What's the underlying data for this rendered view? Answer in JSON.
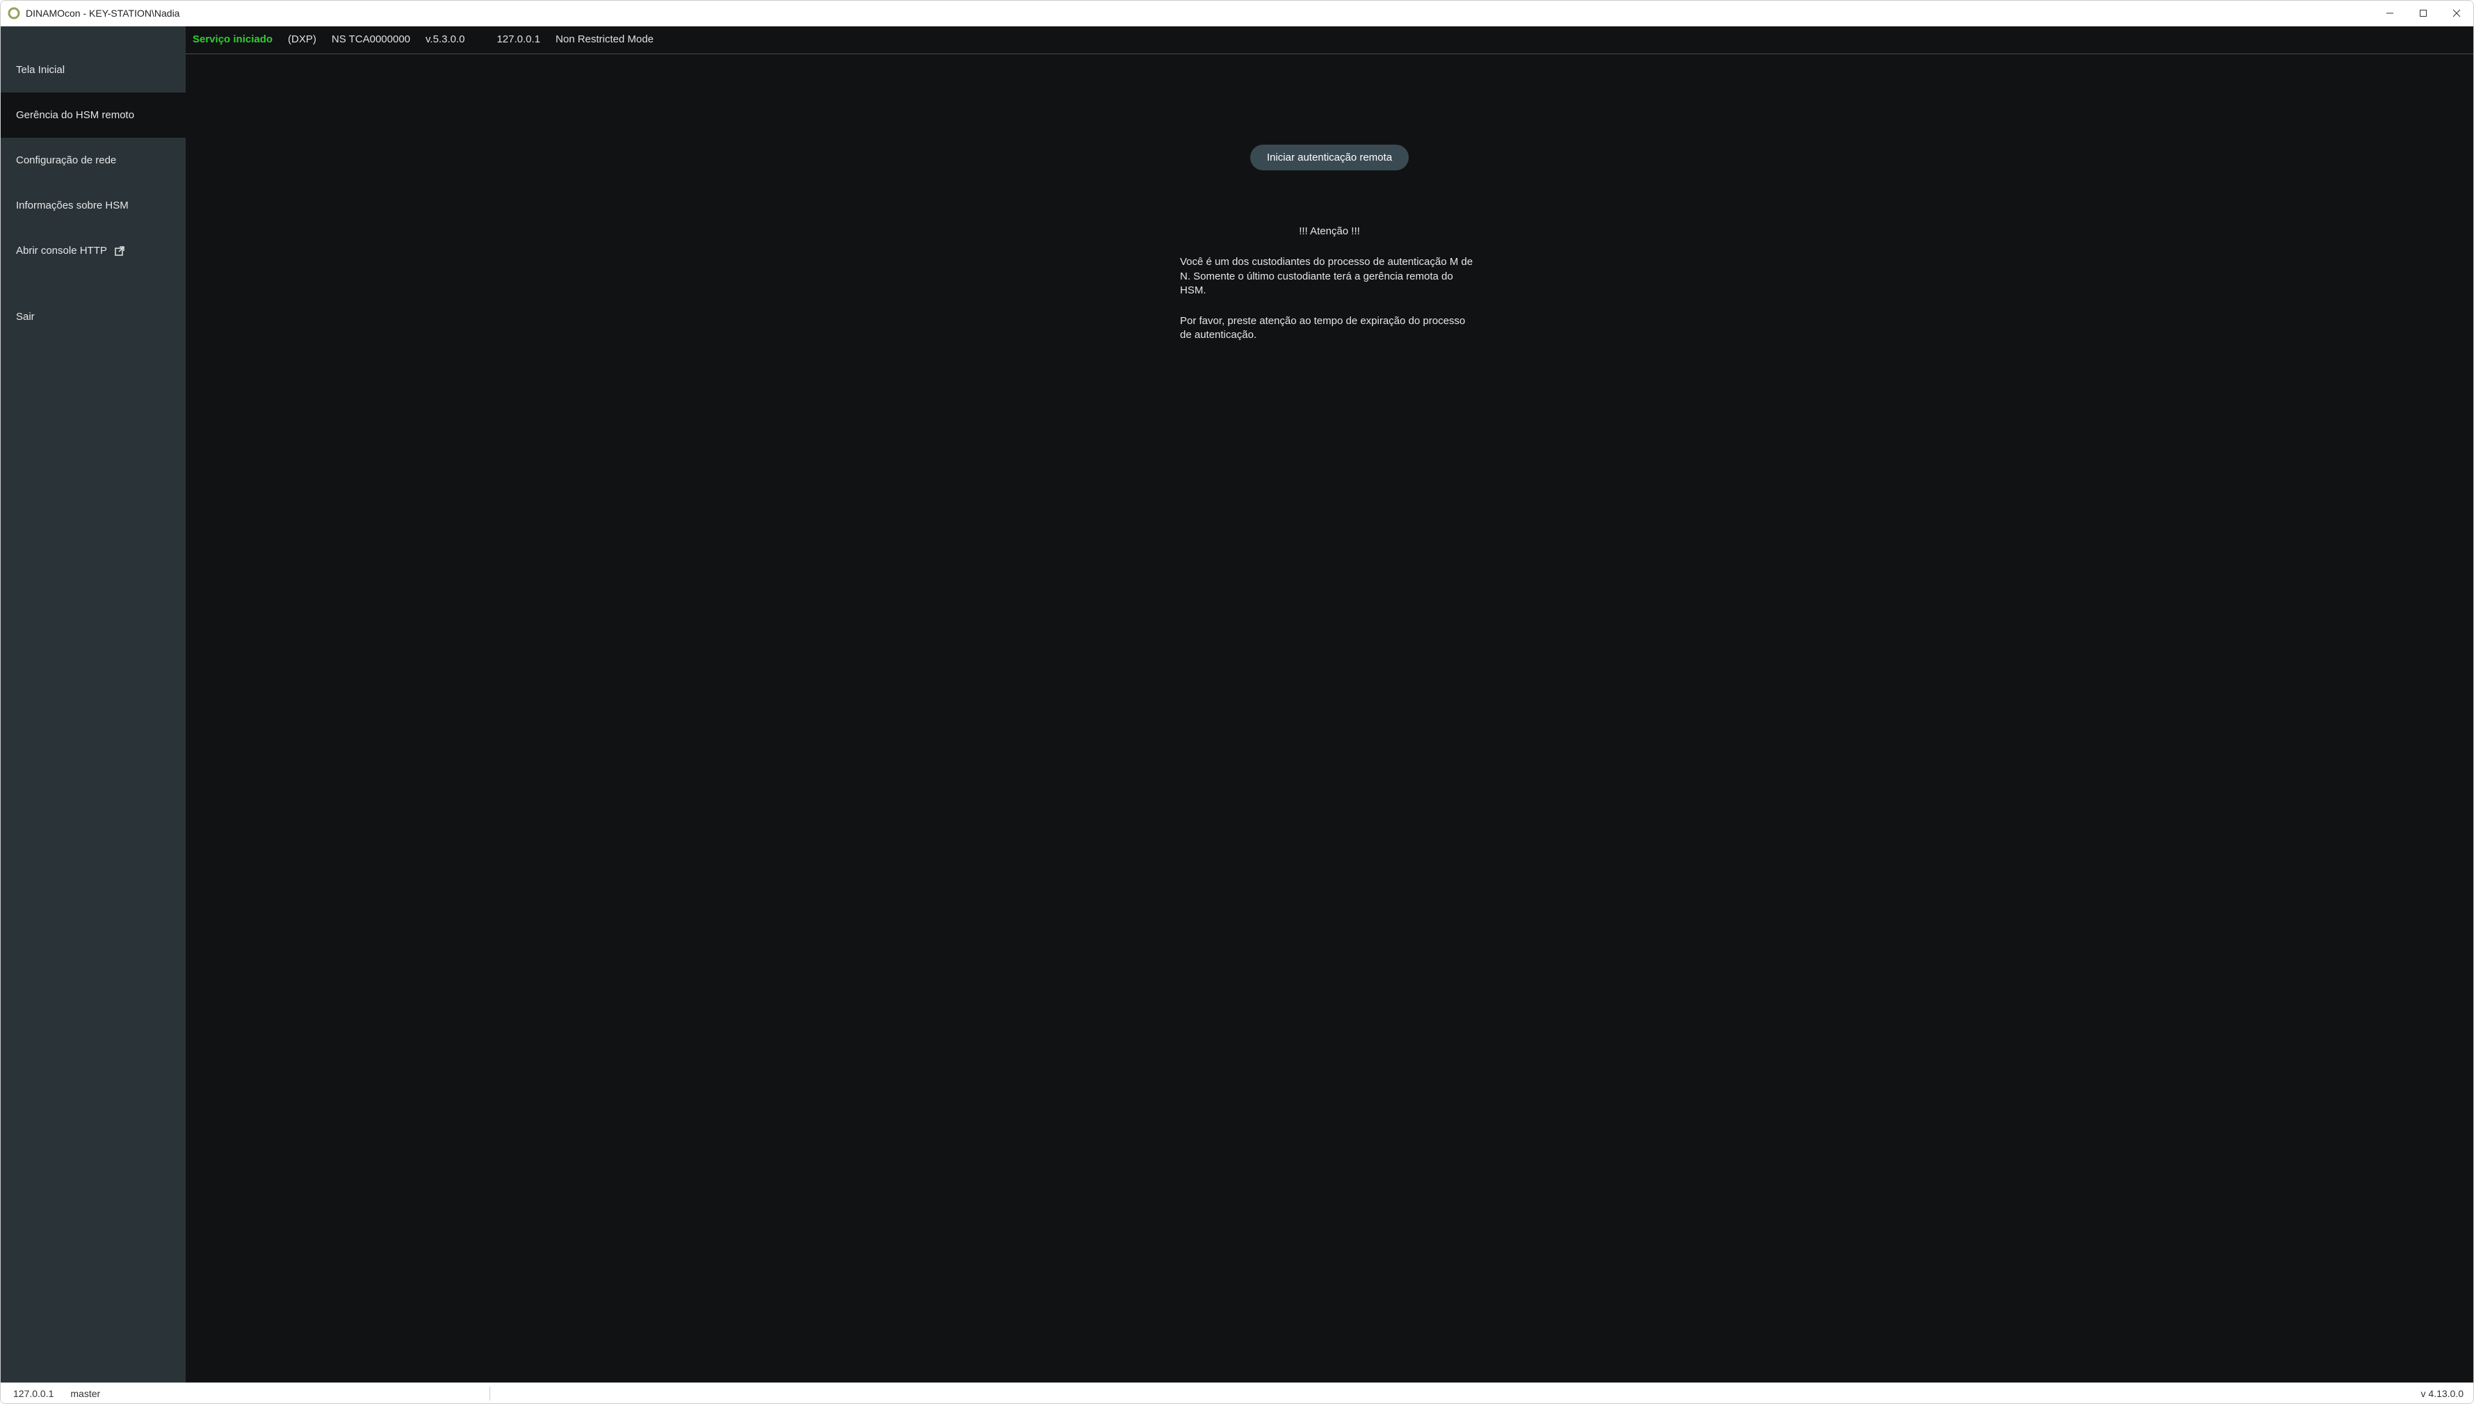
{
  "titlebar": {
    "title": "DINAMOcon - KEY-STATION\\Nadia"
  },
  "sidebar": {
    "items": [
      {
        "label": "Tela Inicial"
      },
      {
        "label": "Gerência do HSM remoto"
      },
      {
        "label": "Configuração de rede"
      },
      {
        "label": "Informações sobre HSM"
      },
      {
        "label": "Abrir console HTTP"
      },
      {
        "label": "Sair"
      }
    ]
  },
  "topstatus": {
    "service": "Serviço iniciado",
    "model": "(DXP)",
    "serial": "NS TCA0000000",
    "version": "v.5.3.0.0",
    "ip": "127.0.0.1",
    "mode": "Non Restricted Mode"
  },
  "main": {
    "button_label": "Iniciar autenticação remota",
    "warning_title": "!!! Atenção !!!",
    "warning_p1": "Você é um dos custodiantes do processo de autenticação M de N. Somente o último custodiante terá a gerência remota do HSM.",
    "warning_p2": "Por favor, preste atenção ao tempo de expiração do processo de autenticação."
  },
  "statusbar": {
    "ip": "127.0.0.1",
    "user": "master",
    "version": "v 4.13.0.0"
  }
}
